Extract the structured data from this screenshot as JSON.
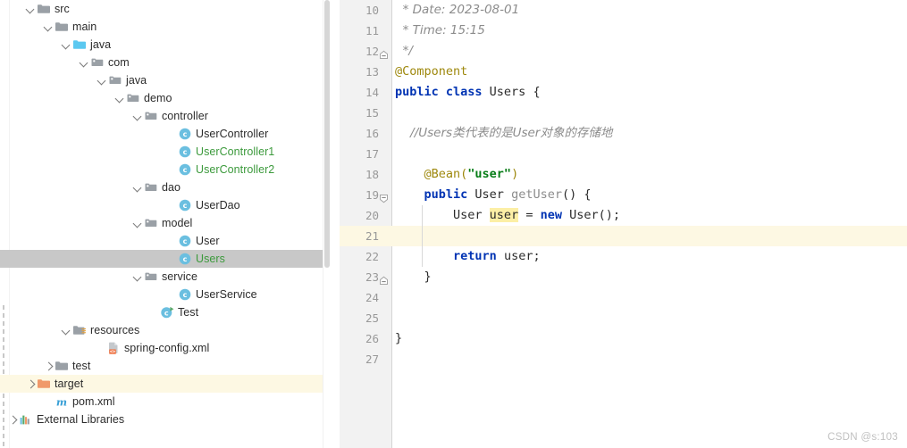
{
  "project_tree": {
    "rows": [
      {
        "label": "src",
        "indent": 28,
        "chevron": "down",
        "icon": "folder-gray",
        "color": "default",
        "state": "normal"
      },
      {
        "label": "main",
        "indent": 48,
        "chevron": "down",
        "icon": "folder-gray",
        "color": "default",
        "state": "normal"
      },
      {
        "label": "java",
        "indent": 68,
        "chevron": "down",
        "icon": "folder-sources",
        "color": "default",
        "state": "normal"
      },
      {
        "label": "com",
        "indent": 88,
        "chevron": "down",
        "icon": "package",
        "color": "default",
        "state": "normal"
      },
      {
        "label": "java",
        "indent": 108,
        "chevron": "down",
        "icon": "package",
        "color": "default",
        "state": "normal"
      },
      {
        "label": "demo",
        "indent": 128,
        "chevron": "down",
        "icon": "package",
        "color": "default",
        "state": "normal"
      },
      {
        "label": "controller",
        "indent": 148,
        "chevron": "down",
        "icon": "package",
        "color": "default",
        "state": "normal"
      },
      {
        "label": "UserController",
        "indent": 186,
        "chevron": "none",
        "icon": "java-class",
        "color": "default",
        "state": "normal"
      },
      {
        "label": "UserController1",
        "indent": 186,
        "chevron": "none",
        "icon": "java-class",
        "color": "green",
        "state": "normal"
      },
      {
        "label": "UserController2",
        "indent": 186,
        "chevron": "none",
        "icon": "java-class",
        "color": "green",
        "state": "normal"
      },
      {
        "label": "dao",
        "indent": 148,
        "chevron": "down",
        "icon": "package",
        "color": "default",
        "state": "normal"
      },
      {
        "label": "UserDao",
        "indent": 186,
        "chevron": "none",
        "icon": "java-class",
        "color": "default",
        "state": "normal"
      },
      {
        "label": "model",
        "indent": 148,
        "chevron": "down",
        "icon": "package",
        "color": "default",
        "state": "normal"
      },
      {
        "label": "User",
        "indent": 186,
        "chevron": "none",
        "icon": "java-class",
        "color": "default",
        "state": "normal"
      },
      {
        "label": "Users",
        "indent": 186,
        "chevron": "none",
        "icon": "java-class",
        "color": "green",
        "state": "selected"
      },
      {
        "label": "service",
        "indent": 148,
        "chevron": "down",
        "icon": "package",
        "color": "default",
        "state": "normal"
      },
      {
        "label": "UserService",
        "indent": 186,
        "chevron": "none",
        "icon": "java-class",
        "color": "default",
        "state": "normal"
      },
      {
        "label": "Test",
        "indent": 166,
        "chevron": "none",
        "icon": "java-class-runnable",
        "color": "default",
        "state": "normal"
      },
      {
        "label": "resources",
        "indent": 68,
        "chevron": "down",
        "icon": "folder-resources",
        "color": "default",
        "state": "normal"
      },
      {
        "label": "spring-config.xml",
        "indent": 106,
        "chevron": "none",
        "icon": "spring-xml",
        "color": "default",
        "state": "normal"
      },
      {
        "label": "test",
        "indent": 48,
        "chevron": "right",
        "icon": "folder-gray",
        "color": "default",
        "state": "normal"
      },
      {
        "label": "target",
        "indent": 28,
        "chevron": "right",
        "icon": "folder-orange",
        "color": "default",
        "state": "excluded"
      },
      {
        "label": "pom.xml",
        "indent": 48,
        "chevron": "none",
        "icon": "maven-pom",
        "color": "default",
        "state": "normal"
      },
      {
        "label": "External Libraries",
        "indent": 8,
        "chevron": "right",
        "icon": "library",
        "color": "default",
        "state": "normal"
      }
    ]
  },
  "editor": {
    "lines": [
      {
        "num": "10",
        "caret": false,
        "fold": "none",
        "guide": false,
        "tokens": [
          {
            "t": "  * Date: 2023-08-01",
            "c": "tok-comment"
          }
        ]
      },
      {
        "num": "11",
        "caret": false,
        "fold": "none",
        "guide": false,
        "tokens": [
          {
            "t": "  * Time: 15:15",
            "c": "tok-comment"
          }
        ]
      },
      {
        "num": "12",
        "caret": false,
        "fold": "end",
        "guide": false,
        "tokens": [
          {
            "t": "  */",
            "c": "tok-comment"
          }
        ]
      },
      {
        "num": "13",
        "caret": false,
        "fold": "none",
        "guide": false,
        "tokens": [
          {
            "t": "@Component",
            "c": "tok-anno"
          }
        ]
      },
      {
        "num": "14",
        "caret": false,
        "fold": "none",
        "guide": false,
        "tokens": [
          {
            "t": "public class ",
            "c": "tok-kw"
          },
          {
            "t": "Users {",
            "c": "tok-plain"
          }
        ]
      },
      {
        "num": "15",
        "caret": false,
        "fold": "none",
        "guide": false,
        "tokens": []
      },
      {
        "num": "16",
        "caret": false,
        "fold": "none",
        "guide": false,
        "tokens": [
          {
            "t": "    //Users类代表的是User对象的存储地",
            "c": "tok-comment"
          }
        ]
      },
      {
        "num": "17",
        "caret": false,
        "fold": "none",
        "guide": false,
        "tokens": []
      },
      {
        "num": "18",
        "caret": false,
        "fold": "none",
        "guide": false,
        "tokens": [
          {
            "t": "    @Bean(",
            "c": "tok-anno"
          },
          {
            "t": "\"user\"",
            "c": "tok-str"
          },
          {
            "t": ")",
            "c": "tok-anno"
          }
        ]
      },
      {
        "num": "19",
        "caret": false,
        "fold": "start",
        "guide": false,
        "tokens": [
          {
            "t": "    ",
            "c": "tok-plain"
          },
          {
            "t": "public ",
            "c": "tok-kw"
          },
          {
            "t": "User ",
            "c": "tok-type"
          },
          {
            "t": "getUser",
            "c": "tok-method"
          },
          {
            "t": "() {",
            "c": "tok-plain"
          }
        ]
      },
      {
        "num": "20",
        "caret": false,
        "fold": "none",
        "guide": true,
        "tokens": [
          {
            "t": "        User ",
            "c": "tok-plain"
          },
          {
            "t": "user",
            "c": "tok-plain tok-ident-hl"
          },
          {
            "t": " = ",
            "c": "tok-plain"
          },
          {
            "t": "new ",
            "c": "tok-kw"
          },
          {
            "t": "User();",
            "c": "tok-plain"
          }
        ]
      },
      {
        "num": "21",
        "caret": true,
        "fold": "none",
        "guide": true,
        "tokens": []
      },
      {
        "num": "22",
        "caret": false,
        "fold": "none",
        "guide": true,
        "tokens": [
          {
            "t": "        ",
            "c": "tok-plain"
          },
          {
            "t": "return ",
            "c": "tok-kw"
          },
          {
            "t": "user;",
            "c": "tok-plain"
          }
        ]
      },
      {
        "num": "23",
        "caret": false,
        "fold": "end",
        "guide": false,
        "tokens": [
          {
            "t": "    }",
            "c": "tok-plain"
          }
        ]
      },
      {
        "num": "24",
        "caret": false,
        "fold": "none",
        "guide": false,
        "tokens": []
      },
      {
        "num": "25",
        "caret": false,
        "fold": "none",
        "guide": false,
        "tokens": []
      },
      {
        "num": "26",
        "caret": false,
        "fold": "none",
        "guide": false,
        "tokens": [
          {
            "t": "}",
            "c": "tok-plain"
          }
        ]
      },
      {
        "num": "27",
        "caret": false,
        "fold": "none",
        "guide": false,
        "tokens": []
      }
    ]
  },
  "watermark": {
    "text": "CSDN @s:103"
  },
  "colors": {
    "selection_bg": "#c8c8c8",
    "excluded_row_bg": "#fdf8e3",
    "caret_line_bg": "#fdf8e3",
    "identifier_highlight_bg": "#fcefa6",
    "gutter_bg": "#f2f2f2",
    "vcs_added_green": "#3c9a3c",
    "keyword_blue": "#0033b3",
    "string_green": "#067d17",
    "annotation_gold": "#9e880d",
    "comment_gray": "#8c8c8c"
  }
}
